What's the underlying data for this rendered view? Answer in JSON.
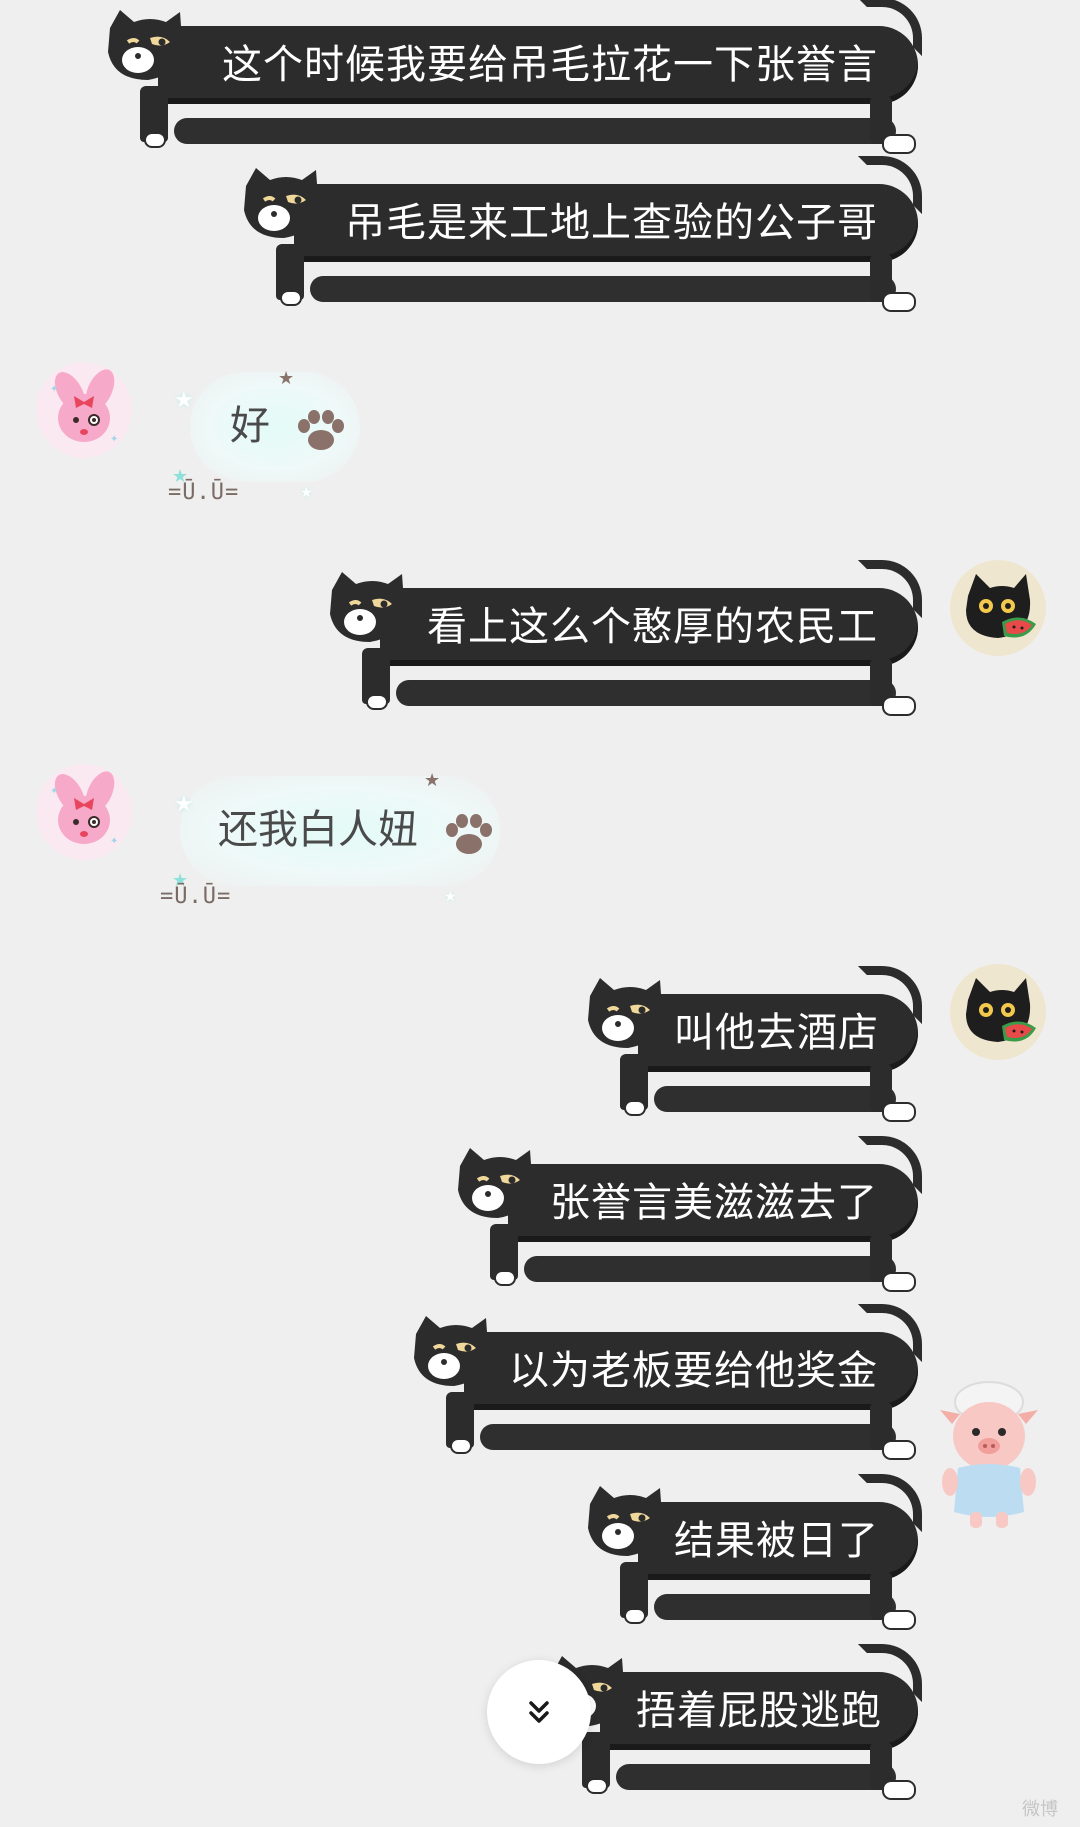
{
  "colors": {
    "background": "#efefef",
    "cat_bubble": "#2c2c2c",
    "cat_text": "#ffffff",
    "cloud_text": "#4a4a4a",
    "cloud_glow": "#e3fbf8",
    "paw": "#8a716a",
    "star_brown": "#8a716a",
    "star_teal": "#8fe0da"
  },
  "messages": [
    {
      "id": 1,
      "side": "right",
      "style": "cat",
      "text": "这个时候我要给吊毛拉花一下张誉言",
      "avatar": ""
    },
    {
      "id": 2,
      "side": "right",
      "style": "cat",
      "text": "吊毛是来工地上查验的公子哥",
      "avatar": ""
    },
    {
      "id": 3,
      "side": "left",
      "style": "cloud",
      "text": "好",
      "avatar": "pink-bunny-avatar",
      "decor_face": "=Ū.Ū="
    },
    {
      "id": 4,
      "side": "right",
      "style": "cat",
      "text": "看上这么个憨厚的农民工",
      "avatar": "black-cat-watermelon-avatar"
    },
    {
      "id": 5,
      "side": "left",
      "style": "cloud",
      "text": "还我白人妞",
      "avatar": "pink-bunny-avatar",
      "decor_face": "=Ū.Ū="
    },
    {
      "id": 6,
      "side": "right",
      "style": "cat",
      "text": "叫他去酒店",
      "avatar": "black-cat-watermelon-avatar"
    },
    {
      "id": 7,
      "side": "right",
      "style": "cat",
      "text": "张誉言美滋滋去了",
      "avatar": ""
    },
    {
      "id": 8,
      "side": "right",
      "style": "cat",
      "text": "以为老板要给他奖金",
      "avatar": "pig-towel-avatar"
    },
    {
      "id": 9,
      "side": "right",
      "style": "cat",
      "text": "结果被日了",
      "avatar": ""
    },
    {
      "id": 10,
      "side": "right",
      "style": "cat",
      "text": "捂着屁股逃跑",
      "avatar": ""
    }
  ],
  "scroll_button": {
    "icon": "double-chevron-down-icon"
  },
  "watermark": "微博"
}
